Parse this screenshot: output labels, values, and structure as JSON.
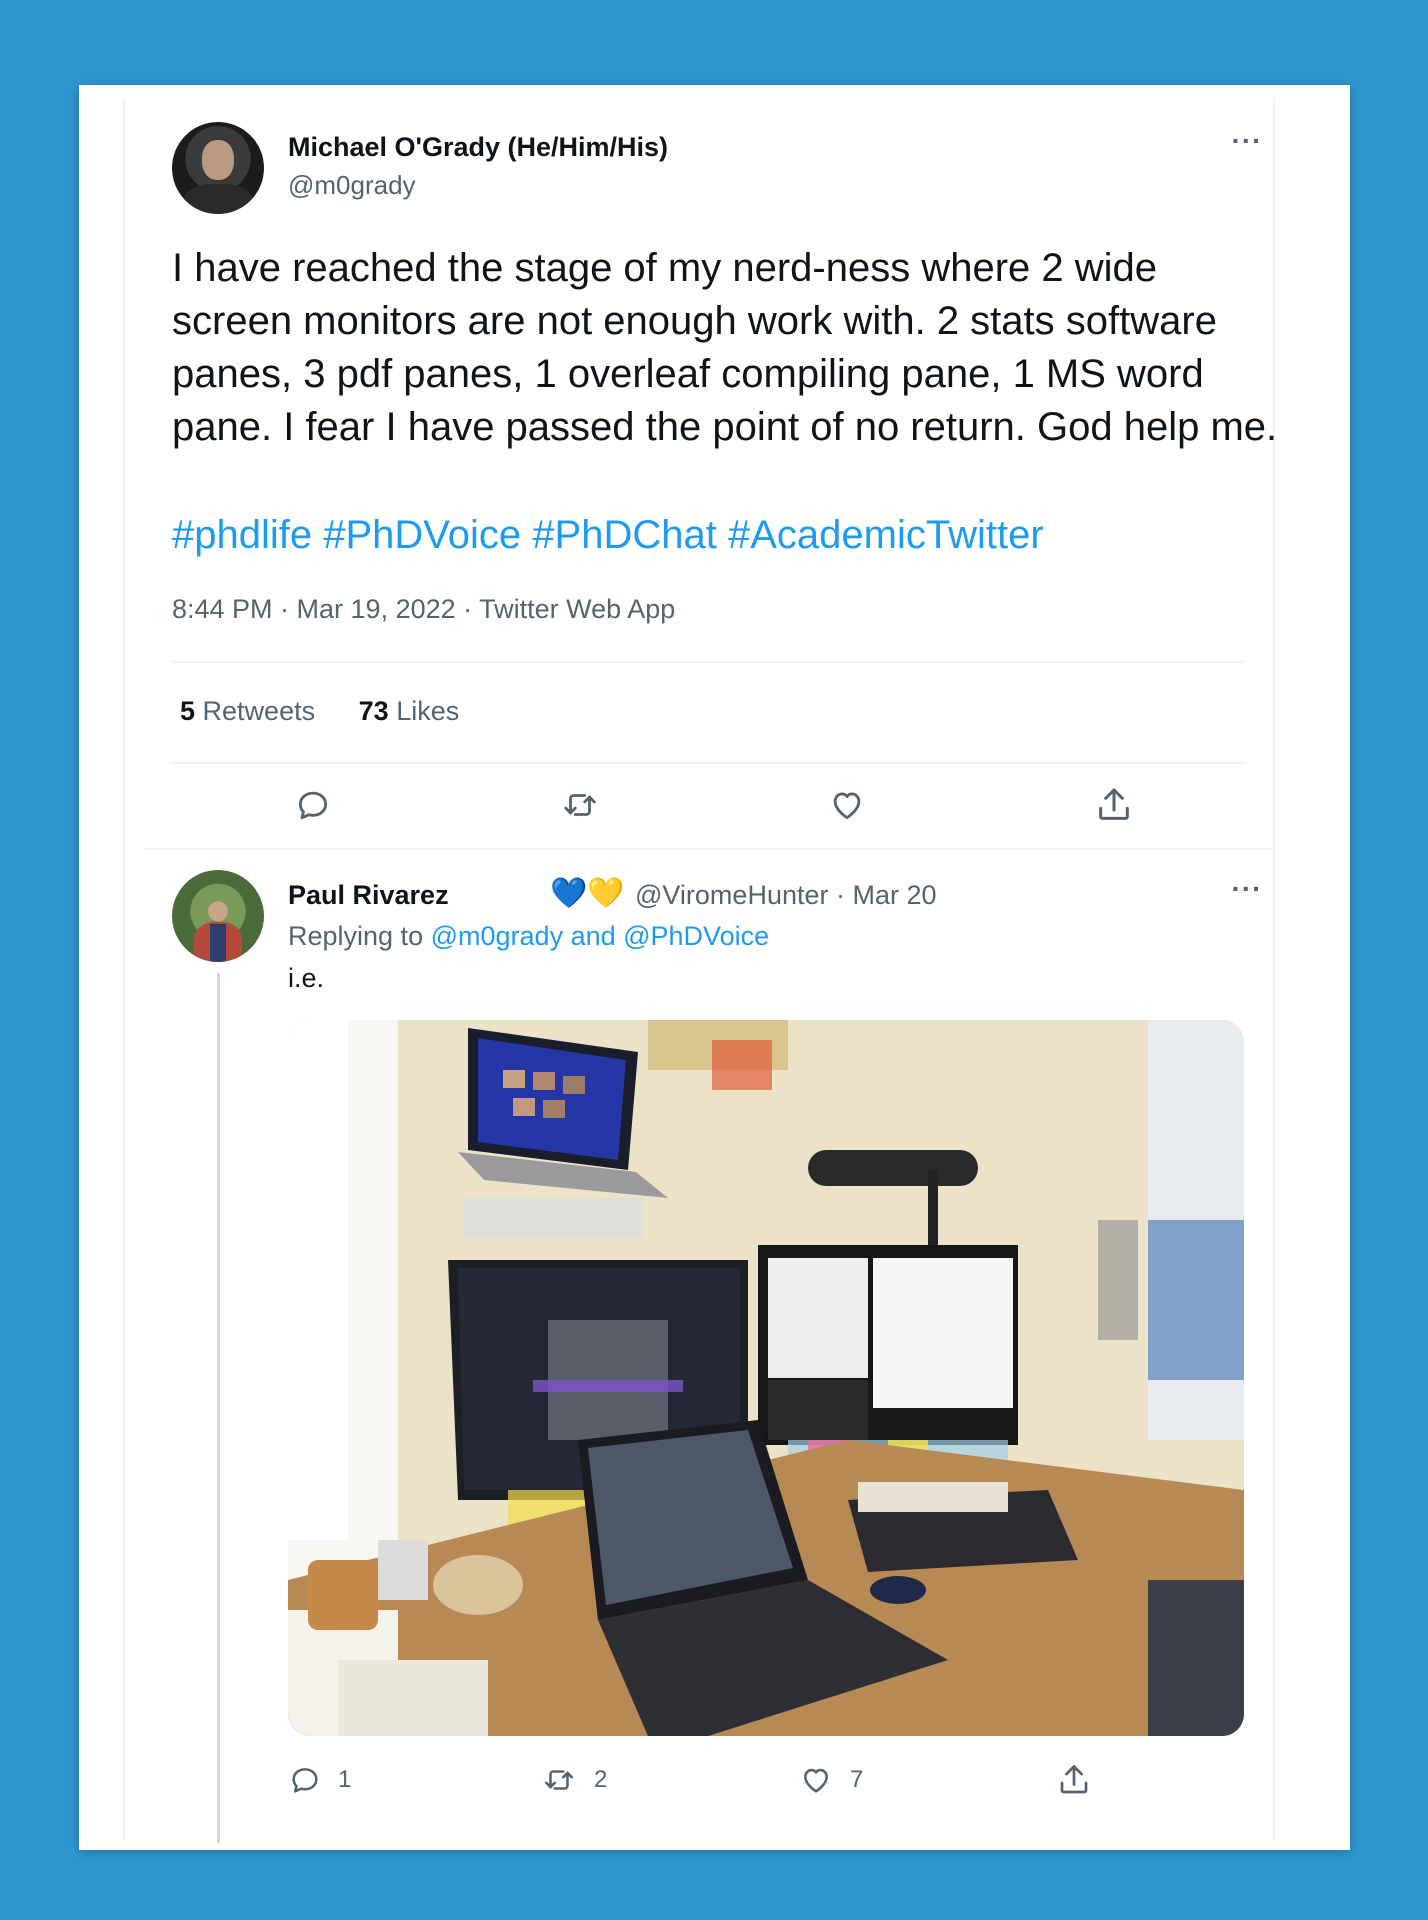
{
  "tweet": {
    "author_name": "Michael O'Grady (He/Him/His)",
    "author_handle": "@m0grady",
    "more_label": "···",
    "text": "I have reached the stage of my nerd-ness where 2 wide screen monitors are not enough work with. 2 stats software panes, 3 pdf panes, 1 overleaf compiling pane, 1 MS word pane. I fear I have passed the point of no return. God help me.",
    "hashtags": [
      "#phdlife",
      "#PhDVoice",
      "#PhDChat",
      "#AcademicTwitter"
    ],
    "meta": "8:44 PM · Mar 19, 2022 · Twitter Web App",
    "retweets_count": "5",
    "retweets_label": "Retweets",
    "likes_count": "73",
    "likes_label": "Likes"
  },
  "reply": {
    "author_name": "Paul Rivarez",
    "badges": "💙💛",
    "handle_date": "@ViromeHunter · Mar 20",
    "more_label": "···",
    "replying_prefix": "Replying to",
    "replying_to": "@m0grady and @PhDVoice",
    "text": "i.e.",
    "reply_count": "1",
    "retweet_count": "2",
    "like_count": "7"
  },
  "icons": {
    "reply": "reply-icon",
    "retweet": "retweet-icon",
    "like": "heart-icon",
    "share": "share-icon"
  },
  "colors": {
    "background": "#2e96cf",
    "link": "#1d9bf0",
    "secondary_text": "#536471",
    "primary_text": "#0f1419"
  }
}
